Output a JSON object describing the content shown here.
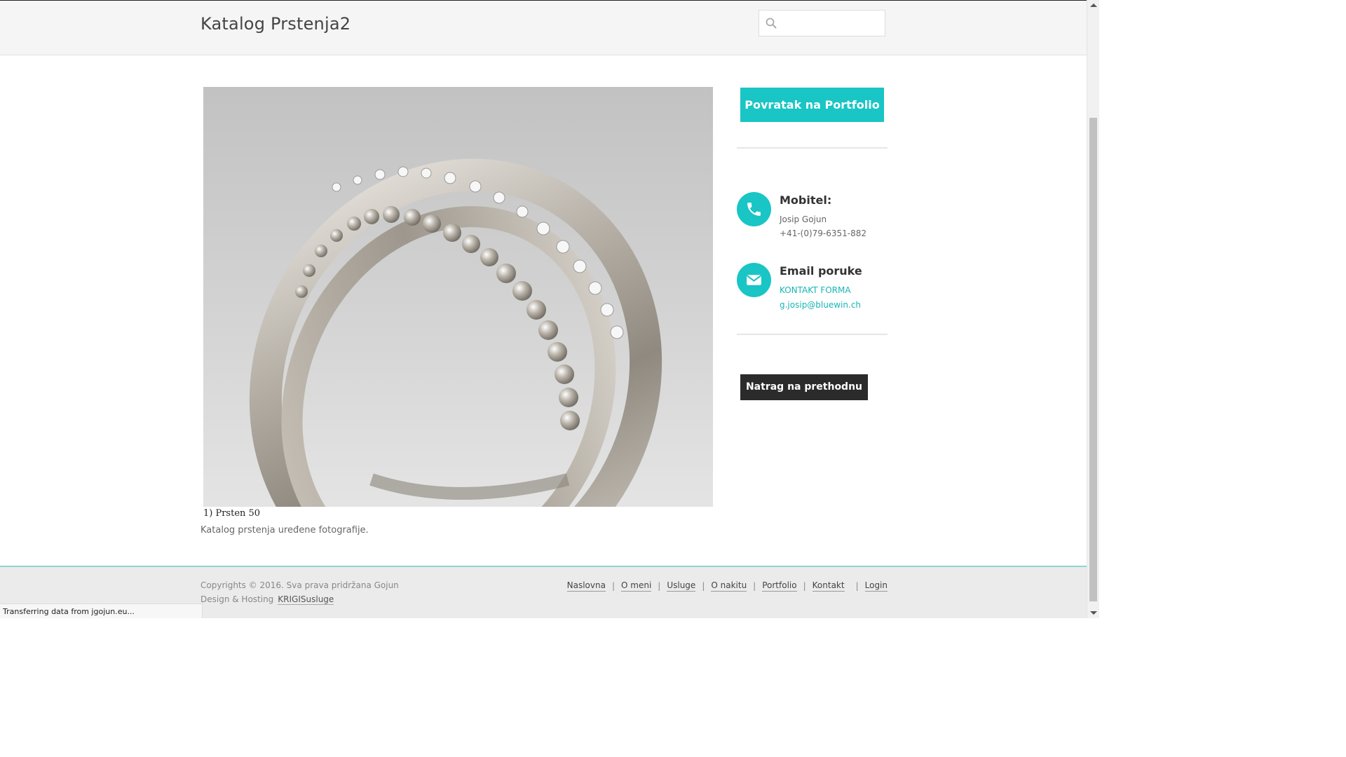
{
  "header": {
    "site_title": "Katalog Prstenja2",
    "search_placeholder": ""
  },
  "main": {
    "photo_caption": "1) Prsten 50",
    "description": "Katalog prstenja uređene fotografije."
  },
  "sidebar": {
    "portfolio_button": "Povratak na Portfolio",
    "phone": {
      "title": "Mobitel:",
      "name": "Josip Gojun",
      "number": "+41-(0)79-6351-882",
      "icon": "phone-icon"
    },
    "email": {
      "title": "Email poruke",
      "contact_form_link": "KONTAKT FORMA",
      "address": "g.josip@bluewin.ch",
      "icon": "envelope-icon"
    },
    "back_button": "Natrag na prethodnu"
  },
  "footer": {
    "copyright": "Copyrights © 2016. Sva prava pridržana Gojun",
    "design_prefix": "Design & Hosting",
    "design_link": "KRIGISusluge",
    "nav": [
      "Naslovna",
      "O meni",
      "Usluge",
      "O nakitu",
      "Portfolio",
      "Kontakt",
      "Login"
    ]
  },
  "status_bar": {
    "text": "Transferring data from jgojun.eu..."
  },
  "colors": {
    "accent": "#19c5c5",
    "dark_button": "#2b2b2b",
    "footer_bg": "#ebebeb",
    "footer_border": "#8ed6d0"
  }
}
